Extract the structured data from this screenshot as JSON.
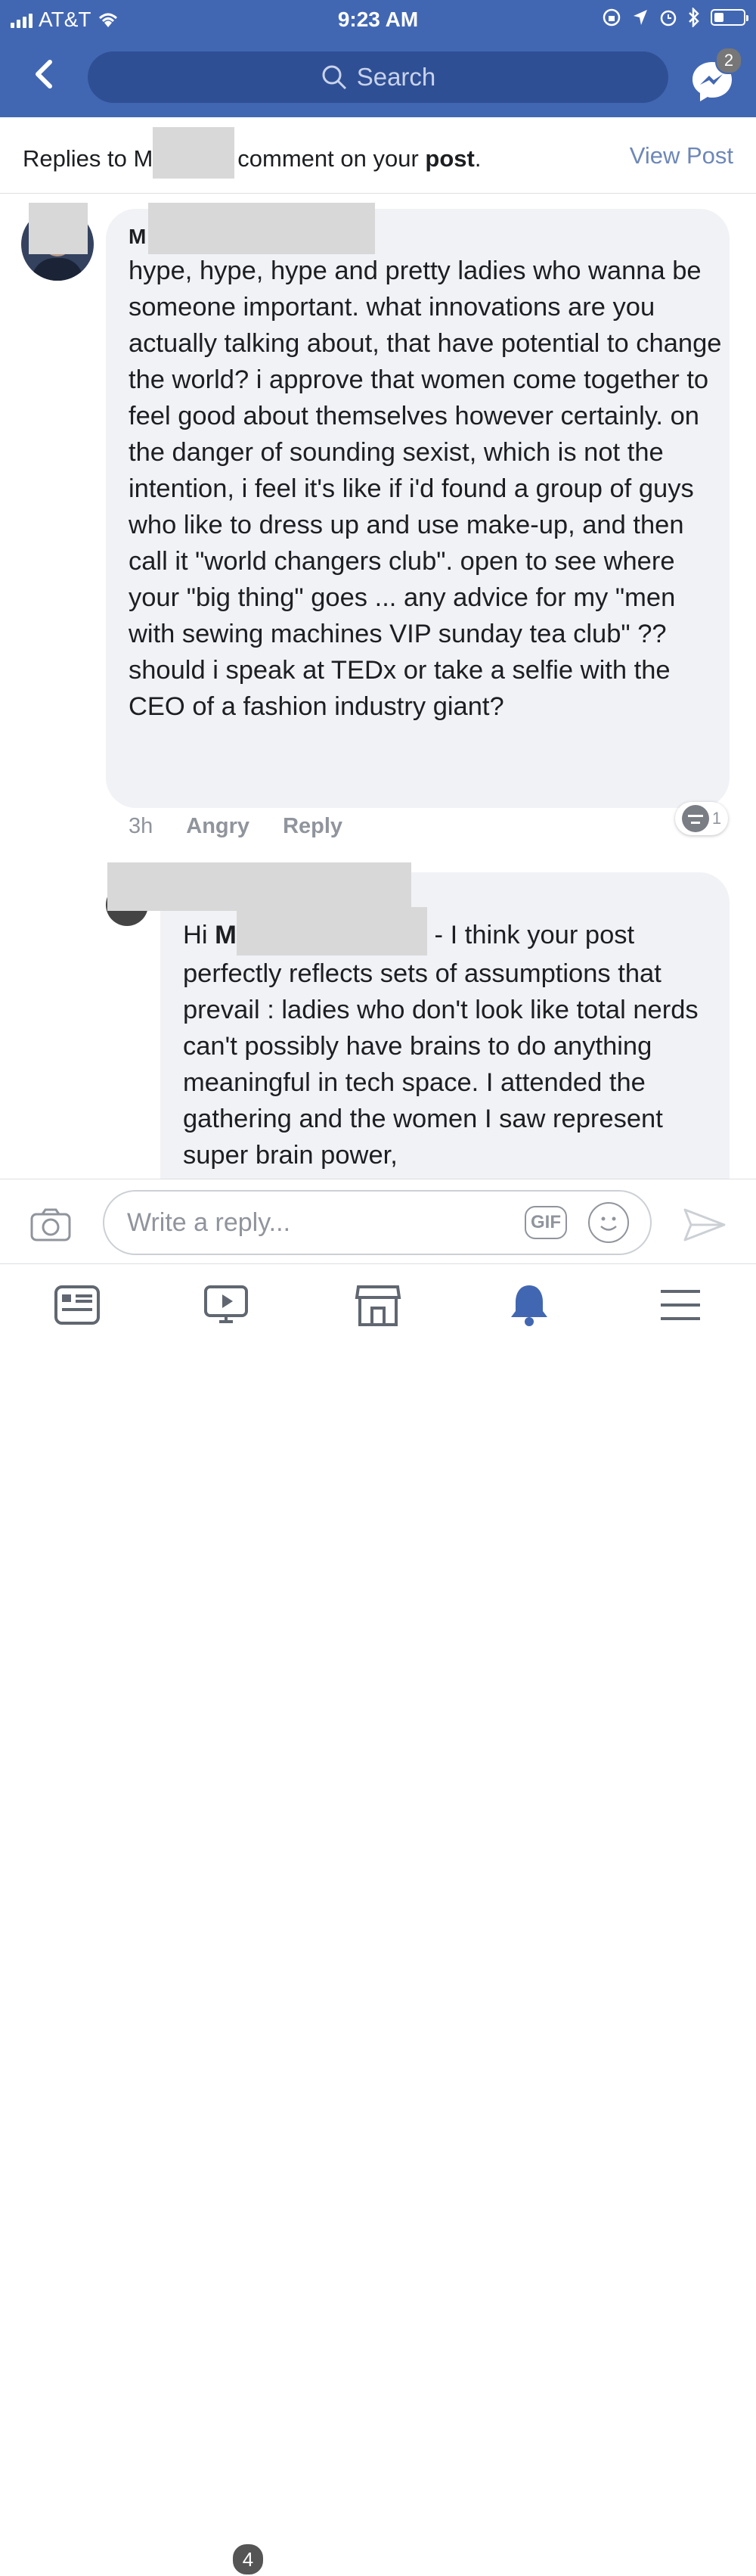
{
  "status_bar": {
    "carrier": "AT&T",
    "time": "9:23 AM"
  },
  "top_bar": {
    "search_placeholder": "Search",
    "messenger_badge": "2"
  },
  "replies_header": {
    "prefix": "Replies to M",
    "middle": "comment on your ",
    "bold": "post",
    "suffix": ".",
    "view_post": "View Post"
  },
  "comment": {
    "author_initial": "M",
    "text": "hype, hype, hype and pretty ladies who wanna be someone important. what innovations are you actually talking about, that have potential to change the world? i approve that women come together to feel good about themselves however certainly. on the danger of sounding sexist, which is not the intention, i feel it's like if i'd found a group of guys who like to dress up and use make-up, and then call it \"world changers club\". open to see where your \"big thing\" goes ... any advice for my \"men with sewing machines VIP sunday tea club\" ?? should i speak at TEDx or take a selfie with the CEO of a fashion industry giant?",
    "time": "3h",
    "reaction_action": "Angry",
    "reply_action": "Reply",
    "reaction_count": "1"
  },
  "reply": {
    "greeting": "Hi ",
    "name_initial": "M",
    "text": " - I think your post perfectly reflects sets of assumptions that prevail : ladies who don't look like total nerds can't possibly have brains to do anything meaningful in tech space. I attended the gathering and the women I saw represent super brain power,"
  },
  "composer": {
    "placeholder": "Write a reply...",
    "gif_label": "GIF"
  },
  "tab_bar": {
    "video_badge": "4"
  },
  "colors": {
    "brand_blue": "#4267b2",
    "link_blue": "#6e87b8",
    "active_tab": "#4267b2",
    "bubble": "#f1f2f6"
  }
}
